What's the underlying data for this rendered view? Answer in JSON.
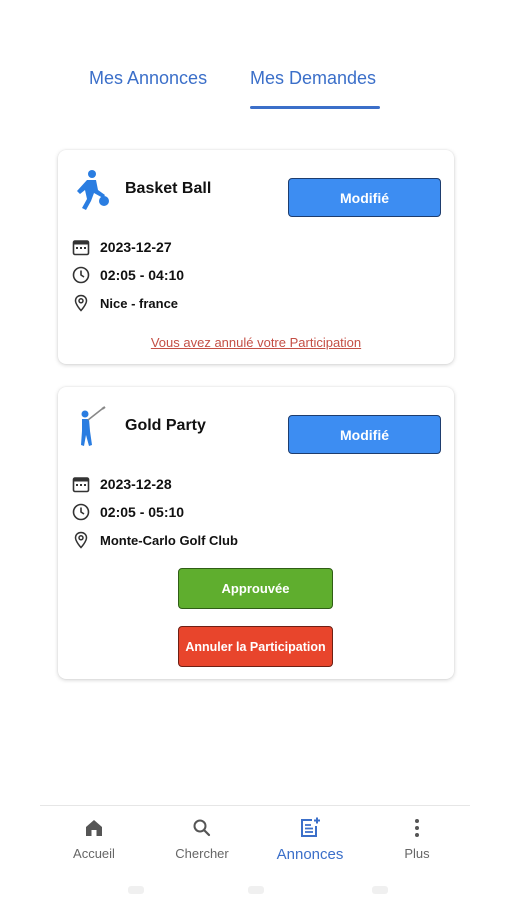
{
  "tabs": [
    {
      "label": "Mes Annonces",
      "active": false
    },
    {
      "label": "Mes Demandes",
      "active": true
    }
  ],
  "cards": [
    {
      "icon": "basketball-player-icon",
      "title": "Basket Ball",
      "modify_label": "Modifié",
      "date": "2023-12-27",
      "time": "02:05 - 04:10",
      "location": "Nice - france",
      "status_link": "Vous avez annulé votre Participation"
    },
    {
      "icon": "golfer-icon",
      "title": "Gold Party",
      "modify_label": "Modifié",
      "date": "2023-12-28",
      "time": "02:05 - 05:10",
      "location": "Monte-Carlo Golf Club",
      "approved_label": "Approuvée",
      "cancel_label": "Annuler la Participation"
    }
  ],
  "bottom_nav": [
    {
      "label": "Accueil",
      "icon": "home-icon"
    },
    {
      "label": "Chercher",
      "icon": "search-icon"
    },
    {
      "label": "Annonces",
      "icon": "post-add-icon",
      "active": true
    },
    {
      "label": "Plus",
      "icon": "more-vertical-icon"
    }
  ],
  "colors": {
    "accent": "#3b6fc9",
    "modify_button": "#3d8df2",
    "approved": "#5fae2e",
    "cancel": "#e8452c",
    "cancelled_link": "#c44f45"
  }
}
